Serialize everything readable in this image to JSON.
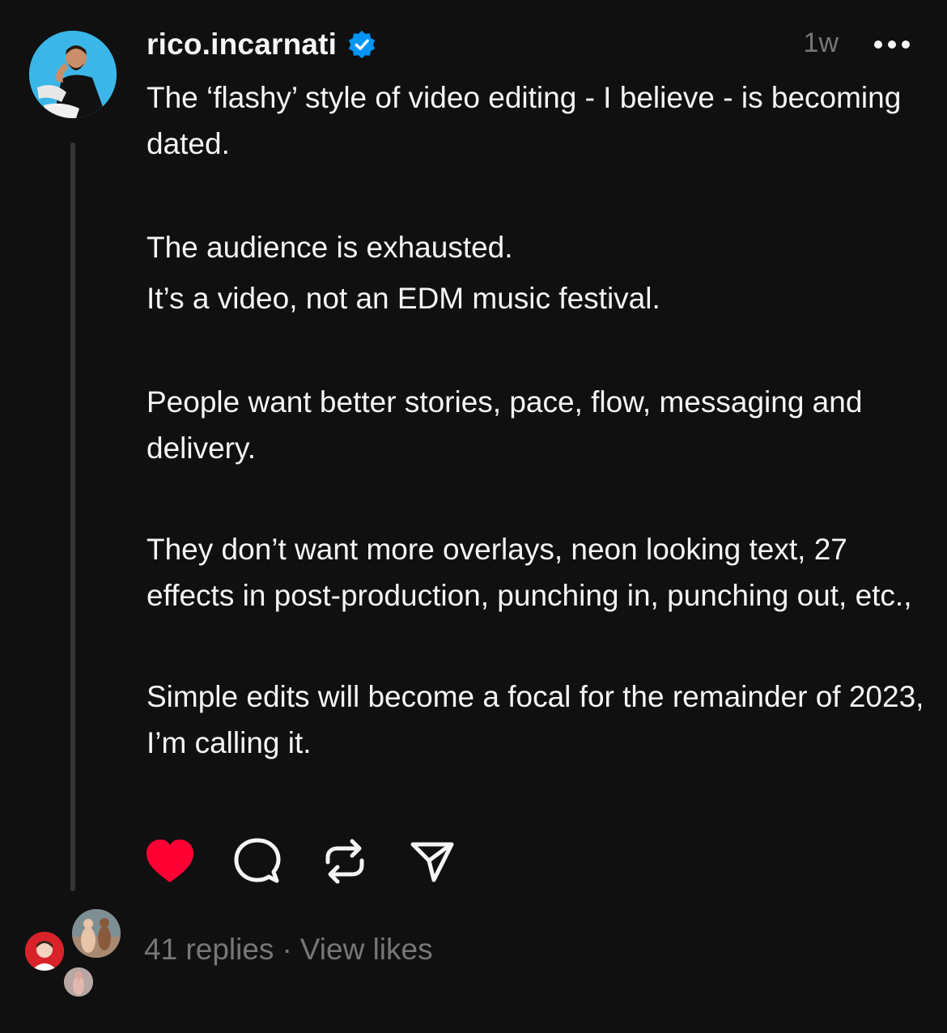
{
  "post": {
    "username": "rico.incarnati",
    "verified_icon": "verified-badge-icon",
    "timestamp": "1w",
    "more_icon": "more-options-icon",
    "paragraphs": [
      "The ‘flashy’ style of video editing - I believe - is becoming dated.",
      "The audience is exhausted.\nIt’s a video, not an EDM music festival.",
      "People want better stories, pace, flow, messaging and delivery.",
      "They don’t want more overlays, neon looking text, 27 effects in post-production, punching in, punching out, etc.,",
      "Simple edits will become a focal for the remainder of 2023, I’m calling it."
    ],
    "actions": {
      "like_icon": "heart-filled-icon",
      "comment_icon": "comment-icon",
      "repost_icon": "repost-icon",
      "share_icon": "send-icon"
    },
    "footer": {
      "replies": "41 replies",
      "separator": "·",
      "view_likes": "View likes"
    }
  },
  "colors": {
    "background": "#101010",
    "text": "#f3f5f7",
    "muted": "#777777",
    "like": "#ff0034",
    "verified": "#0095f6",
    "thread_line": "#333638"
  }
}
